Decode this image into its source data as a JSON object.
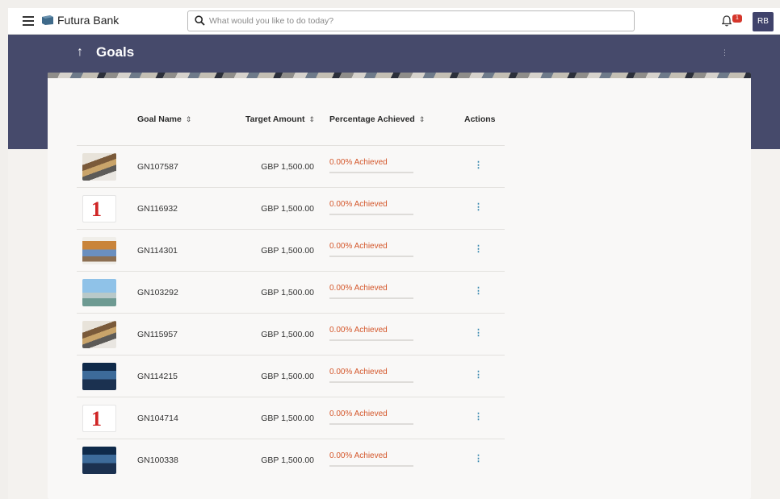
{
  "topbar": {
    "brand": "Futura Bank",
    "search_placeholder": "What would you like to do today?",
    "notification_count": "1",
    "avatar_initials": "RB"
  },
  "header": {
    "title": "Goals"
  },
  "table": {
    "columns": [
      "Goal Name",
      "Target Amount",
      "Percentage Achieved",
      "Actions"
    ],
    "rows": [
      {
        "image": "books-image",
        "goal_name": "GN107587",
        "target_amount": "GBP 1,500.00",
        "achieved": "0.00% Achieved",
        "progress": 0
      },
      {
        "image": "number-one-image",
        "goal_name": "GN116932",
        "target_amount": "GBP 1,500.00",
        "achieved": "0.00% Achieved",
        "progress": 0
      },
      {
        "image": "travel-collage-image",
        "goal_name": "GN114301",
        "target_amount": "GBP 1,500.00",
        "achieved": "0.00% Achieved",
        "progress": 0
      },
      {
        "image": "city-image",
        "goal_name": "GN103292",
        "target_amount": "GBP 1,500.00",
        "achieved": "0.00% Achieved",
        "progress": 0
      },
      {
        "image": "books-image",
        "goal_name": "GN115957",
        "target_amount": "GBP 1,500.00",
        "achieved": "0.00% Achieved",
        "progress": 0
      },
      {
        "image": "car-image",
        "goal_name": "GN114215",
        "target_amount": "GBP 1,500.00",
        "achieved": "0.00% Achieved",
        "progress": 0
      },
      {
        "image": "number-one-image",
        "goal_name": "GN104714",
        "target_amount": "GBP 1,500.00",
        "achieved": "0.00% Achieved",
        "progress": 0
      },
      {
        "image": "car-image",
        "goal_name": "GN100338",
        "target_amount": "GBP 1,500.00",
        "achieved": "0.00% Achieved",
        "progress": 0
      }
    ]
  },
  "colors": {
    "header_band": "#464a6b",
    "achieved_text": "#d4572b",
    "action_icon": "#3a8ab0"
  }
}
